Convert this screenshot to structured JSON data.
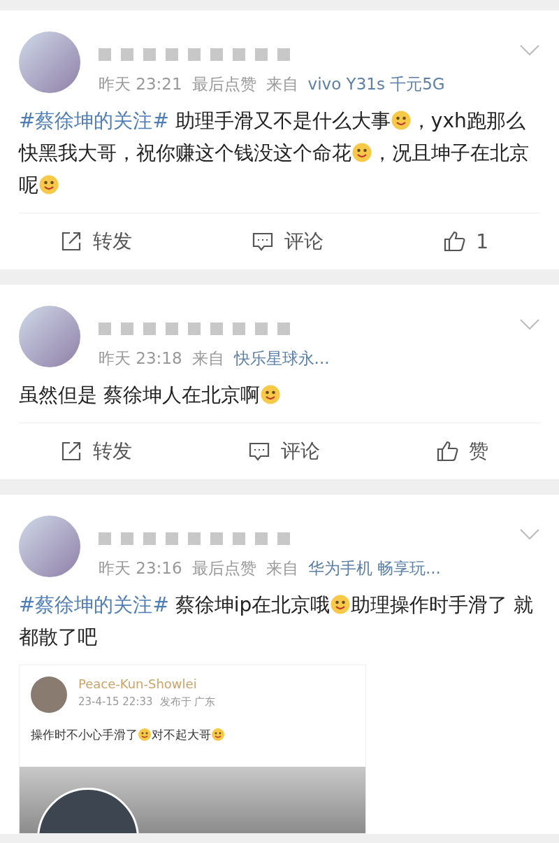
{
  "posts": [
    {
      "meta": {
        "time": "昨天 23:21",
        "note": "最后点赞",
        "from_label": "来自",
        "source": "vivo Y31s 千元5G"
      },
      "body": [
        {
          "kind": "topic",
          "text": "#蔡徐坤的关注#"
        },
        {
          "kind": "text",
          "text": " 助理手滑又不是什么大事"
        },
        {
          "kind": "emoji"
        },
        {
          "kind": "text",
          "text": "，yxh跑那么快黑我大哥，祝你赚这个钱没这个命花"
        },
        {
          "kind": "emoji"
        },
        {
          "kind": "text",
          "text": "，况且坤子在北京呢"
        },
        {
          "kind": "emoji"
        }
      ],
      "actions": [
        {
          "kind": "repost",
          "label": "转发"
        },
        {
          "kind": "comment",
          "label": "评论"
        },
        {
          "kind": "like",
          "label": "1"
        }
      ]
    },
    {
      "meta": {
        "time": "昨天 23:18",
        "from_label": "来自",
        "source": "快乐星球永..."
      },
      "body": [
        {
          "kind": "text",
          "text": "虽然但是 蔡徐坤人在北京啊"
        },
        {
          "kind": "emoji"
        }
      ],
      "actions": [
        {
          "kind": "repost",
          "label": "转发"
        },
        {
          "kind": "comment",
          "label": "评论"
        },
        {
          "kind": "like",
          "label": "赞"
        }
      ]
    },
    {
      "meta": {
        "time": "昨天 23:16",
        "note": "最后点赞",
        "from_label": "来自",
        "source": "华为手机 畅享玩..."
      },
      "body": [
        {
          "kind": "topic",
          "text": "#蔡徐坤的关注#"
        },
        {
          "kind": "text",
          "text": " 蔡徐坤ip在北京哦"
        },
        {
          "kind": "emoji"
        },
        {
          "kind": "text",
          "text": "助理操作时手滑了 就都散了吧"
        }
      ],
      "embed": {
        "name": "Peace-Kun-Showlei",
        "time": "23-4-15 22:33",
        "location": "发布于 广东",
        "body": [
          {
            "kind": "text",
            "text": "操作时不小心手滑了"
          },
          {
            "kind": "emoji"
          },
          {
            "kind": "text",
            "text": "对不起大哥"
          },
          {
            "kind": "emoji"
          }
        ]
      }
    }
  ]
}
